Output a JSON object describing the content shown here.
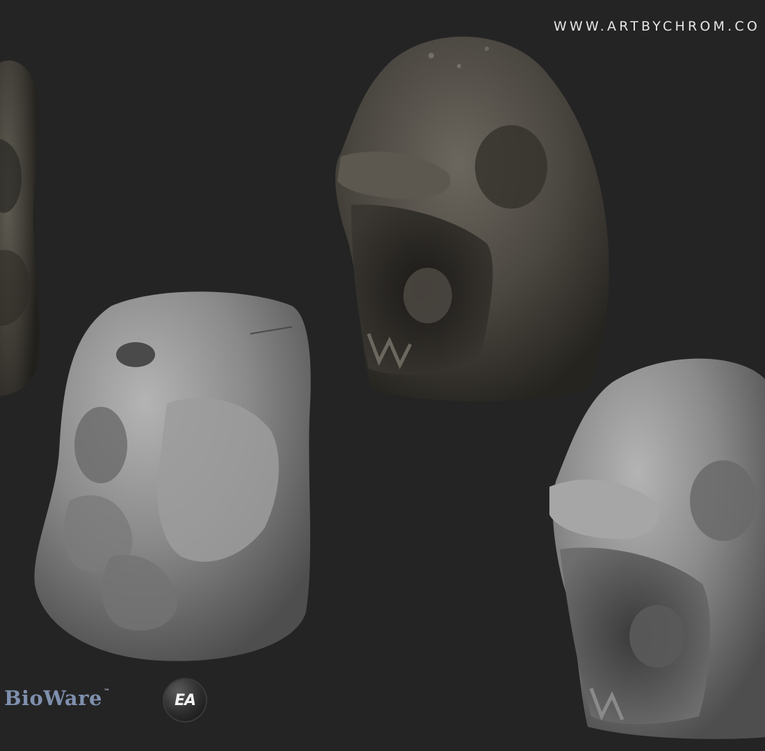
{
  "watermark": {
    "text": "WWW.ARTBYCHROM.CO"
  },
  "logos": {
    "bioware": "BioWare",
    "bioware_tm": "™",
    "ea": "EA"
  },
  "colors": {
    "background": "#242424",
    "bioware_blue": "#7f90ae",
    "stone_dark": "#4a4640",
    "clay_gray": "#8a8a8a"
  },
  "sculptures": [
    {
      "name": "textured stone statue (cropped, left edge)"
    },
    {
      "name": "clay sculpt of crouching figure"
    },
    {
      "name": "textured stone skull-creature head"
    },
    {
      "name": "clay sculpt of skull-creature head"
    }
  ]
}
